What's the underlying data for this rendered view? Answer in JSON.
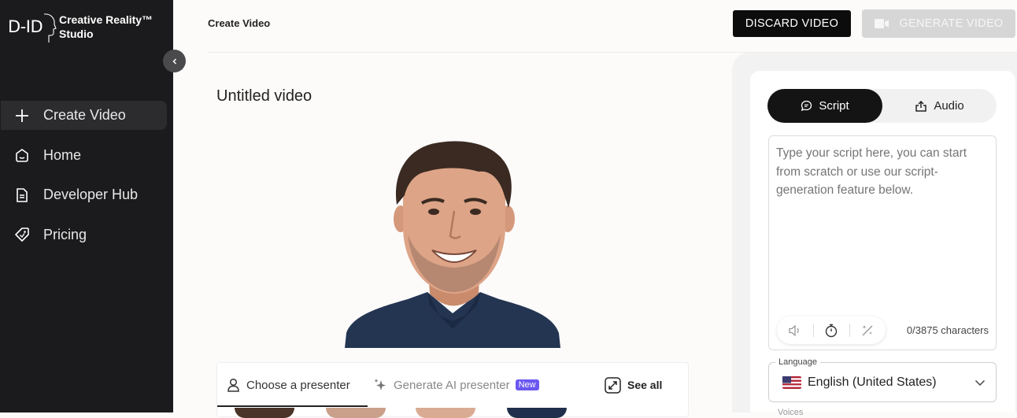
{
  "brand": {
    "logo": "D-ID",
    "name": "Creative Reality™ Studio"
  },
  "sidebar": {
    "items": [
      {
        "label": "Create Video",
        "icon": "plus-icon",
        "active": true
      },
      {
        "label": "Home",
        "icon": "home-icon"
      },
      {
        "label": "Developer Hub",
        "icon": "document-icon"
      },
      {
        "label": "Pricing",
        "icon": "tag-icon"
      }
    ]
  },
  "header": {
    "title": "Create Video",
    "discard_label": "DISCARD VIDEO",
    "generate_label": "GENERATE VIDEO"
  },
  "main": {
    "video_title": "Untitled video",
    "presenter_tabs": {
      "choose": "Choose a presenter",
      "generate": "Generate AI presenter",
      "new_badge": "New",
      "see_all": "See all"
    }
  },
  "script_panel": {
    "tab_script": "Script",
    "tab_audio": "Audio",
    "placeholder": "Type your script here, you can start from scratch or use our script-generation feature below.",
    "char_count": "0/3875 characters",
    "language_label": "Language",
    "language_value": "English (United States)",
    "voices_label": "Voices"
  },
  "colors": {
    "sidebar_bg": "#1b1b1d",
    "accent_badge": "#6b57f2",
    "primary_button": "#0c0c0c",
    "disabled_button": "#d6d6d6"
  }
}
